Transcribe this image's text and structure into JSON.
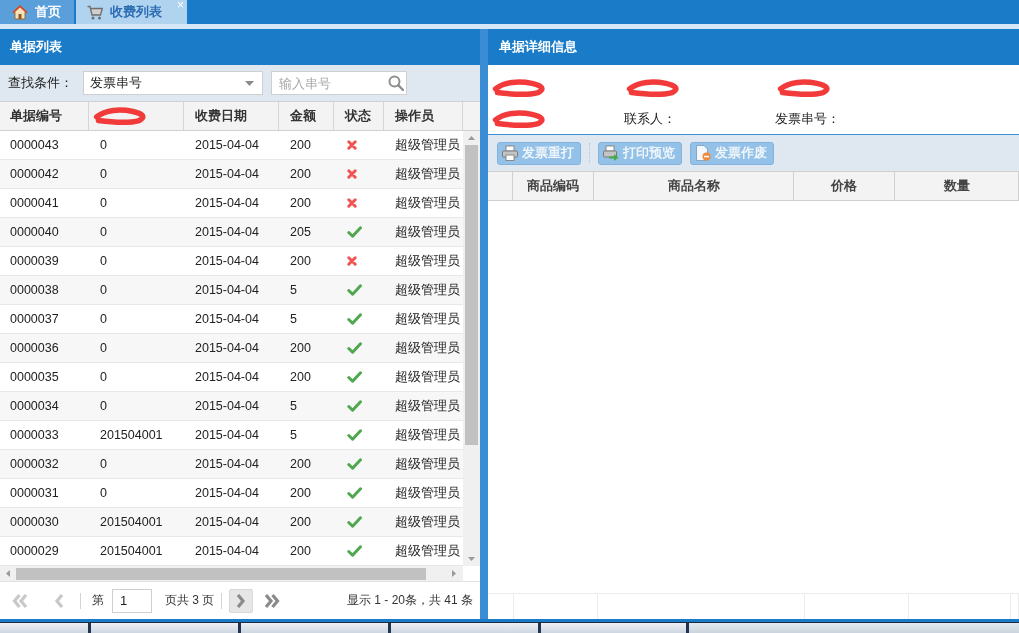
{
  "tabs": [
    {
      "label": "首页",
      "selected": false
    },
    {
      "label": "收费列表",
      "selected": true,
      "close": "×"
    }
  ],
  "list_panel": {
    "title": "单据列表",
    "search": {
      "label": "查找条件：",
      "dropdown": {
        "value": "发票串号"
      },
      "field": {
        "placeholder": "输入串号"
      }
    },
    "table": {
      "columns": [
        {
          "label": "单据编号",
          "redacted": false
        },
        {
          "redacted": true
        },
        {
          "label": "收费日期",
          "redacted": false
        },
        {
          "label": "金额",
          "redacted": false
        },
        {
          "label": "状态",
          "redacted": false
        },
        {
          "label": "操作员",
          "redacted": false
        }
      ],
      "rows": [
        {
          "number": "0000043",
          "column_2": "0",
          "date": "2015-04-04",
          "amount": "200",
          "status_ok": false,
          "operator": "超级管理员"
        },
        {
          "number": "0000042",
          "column_2": "0",
          "date": "2015-04-04",
          "amount": "200",
          "status_ok": false,
          "operator": "超级管理员"
        },
        {
          "number": "0000041",
          "column_2": "0",
          "date": "2015-04-04",
          "amount": "200",
          "status_ok": false,
          "operator": "超级管理员"
        },
        {
          "number": "0000040",
          "column_2": "0",
          "date": "2015-04-04",
          "amount": "205",
          "status_ok": true,
          "operator": "超级管理员"
        },
        {
          "number": "0000039",
          "column_2": "0",
          "date": "2015-04-04",
          "amount": "200",
          "status_ok": false,
          "operator": "超级管理员"
        },
        {
          "number": "0000038",
          "column_2": "0",
          "date": "2015-04-04",
          "amount": "5",
          "status_ok": true,
          "operator": "超级管理员"
        },
        {
          "number": "0000037",
          "column_2": "0",
          "date": "2015-04-04",
          "amount": "5",
          "status_ok": true,
          "operator": "超级管理员"
        },
        {
          "number": "0000036",
          "column_2": "0",
          "date": "2015-04-04",
          "amount": "200",
          "status_ok": true,
          "operator": "超级管理员"
        },
        {
          "number": "0000035",
          "column_2": "0",
          "date": "2015-04-04",
          "amount": "200",
          "status_ok": true,
          "operator": "超级管理员"
        },
        {
          "number": "0000034",
          "column_2": "0",
          "date": "2015-04-04",
          "amount": "5",
          "status_ok": true,
          "operator": "超级管理员"
        },
        {
          "number": "0000033",
          "column_2": "201504001",
          "date": "2015-04-04",
          "amount": "5",
          "status_ok": true,
          "operator": "超级管理员"
        },
        {
          "number": "0000032",
          "column_2": "0",
          "date": "2015-04-04",
          "amount": "200",
          "status_ok": true,
          "operator": "超级管理员"
        },
        {
          "number": "0000031",
          "column_2": "0",
          "date": "2015-04-04",
          "amount": "200",
          "status_ok": true,
          "operator": "超级管理员"
        },
        {
          "number": "0000030",
          "column_2": "201504001",
          "date": "2015-04-04",
          "amount": "200",
          "status_ok": true,
          "operator": "超级管理员"
        },
        {
          "number": "0000029",
          "column_2": "201504001",
          "date": "2015-04-04",
          "amount": "200",
          "status_ok": true,
          "operator": "超级管理员"
        }
      ]
    },
    "pagination": {
      "first": {
        "disabled": true
      },
      "prev": {
        "disabled": true
      },
      "page_prefix": "第",
      "page_value": "1",
      "page_suffix": "页共 3 页",
      "next": {
        "disabled": false,
        "highlighted": true
      },
      "last": {
        "disabled": false,
        "highlighted": false
      },
      "summary": "显示 1 - 20条，共 41 条"
    }
  },
  "detail_panel": {
    "title": "单据详细信息",
    "fields": [
      [
        {
          "redacted": true
        },
        {
          "redacted": true
        },
        {
          "redacted": true
        }
      ],
      [
        {
          "redacted": true
        },
        {
          "label": "联系人：",
          "redacted": false
        },
        {
          "label": "发票串号：",
          "redacted": false
        }
      ]
    ],
    "toolbar": {
      "groups": [
        [
          {
            "label": "发票重打",
            "disabled": true
          }
        ],
        [
          {
            "label": "打印预览",
            "disabled": true
          },
          {
            "label": "发票作废",
            "disabled": true
          }
        ]
      ]
    },
    "grid": {
      "columns": [
        "商品编码",
        "商品名称",
        "价格",
        "数量"
      ]
    }
  }
}
